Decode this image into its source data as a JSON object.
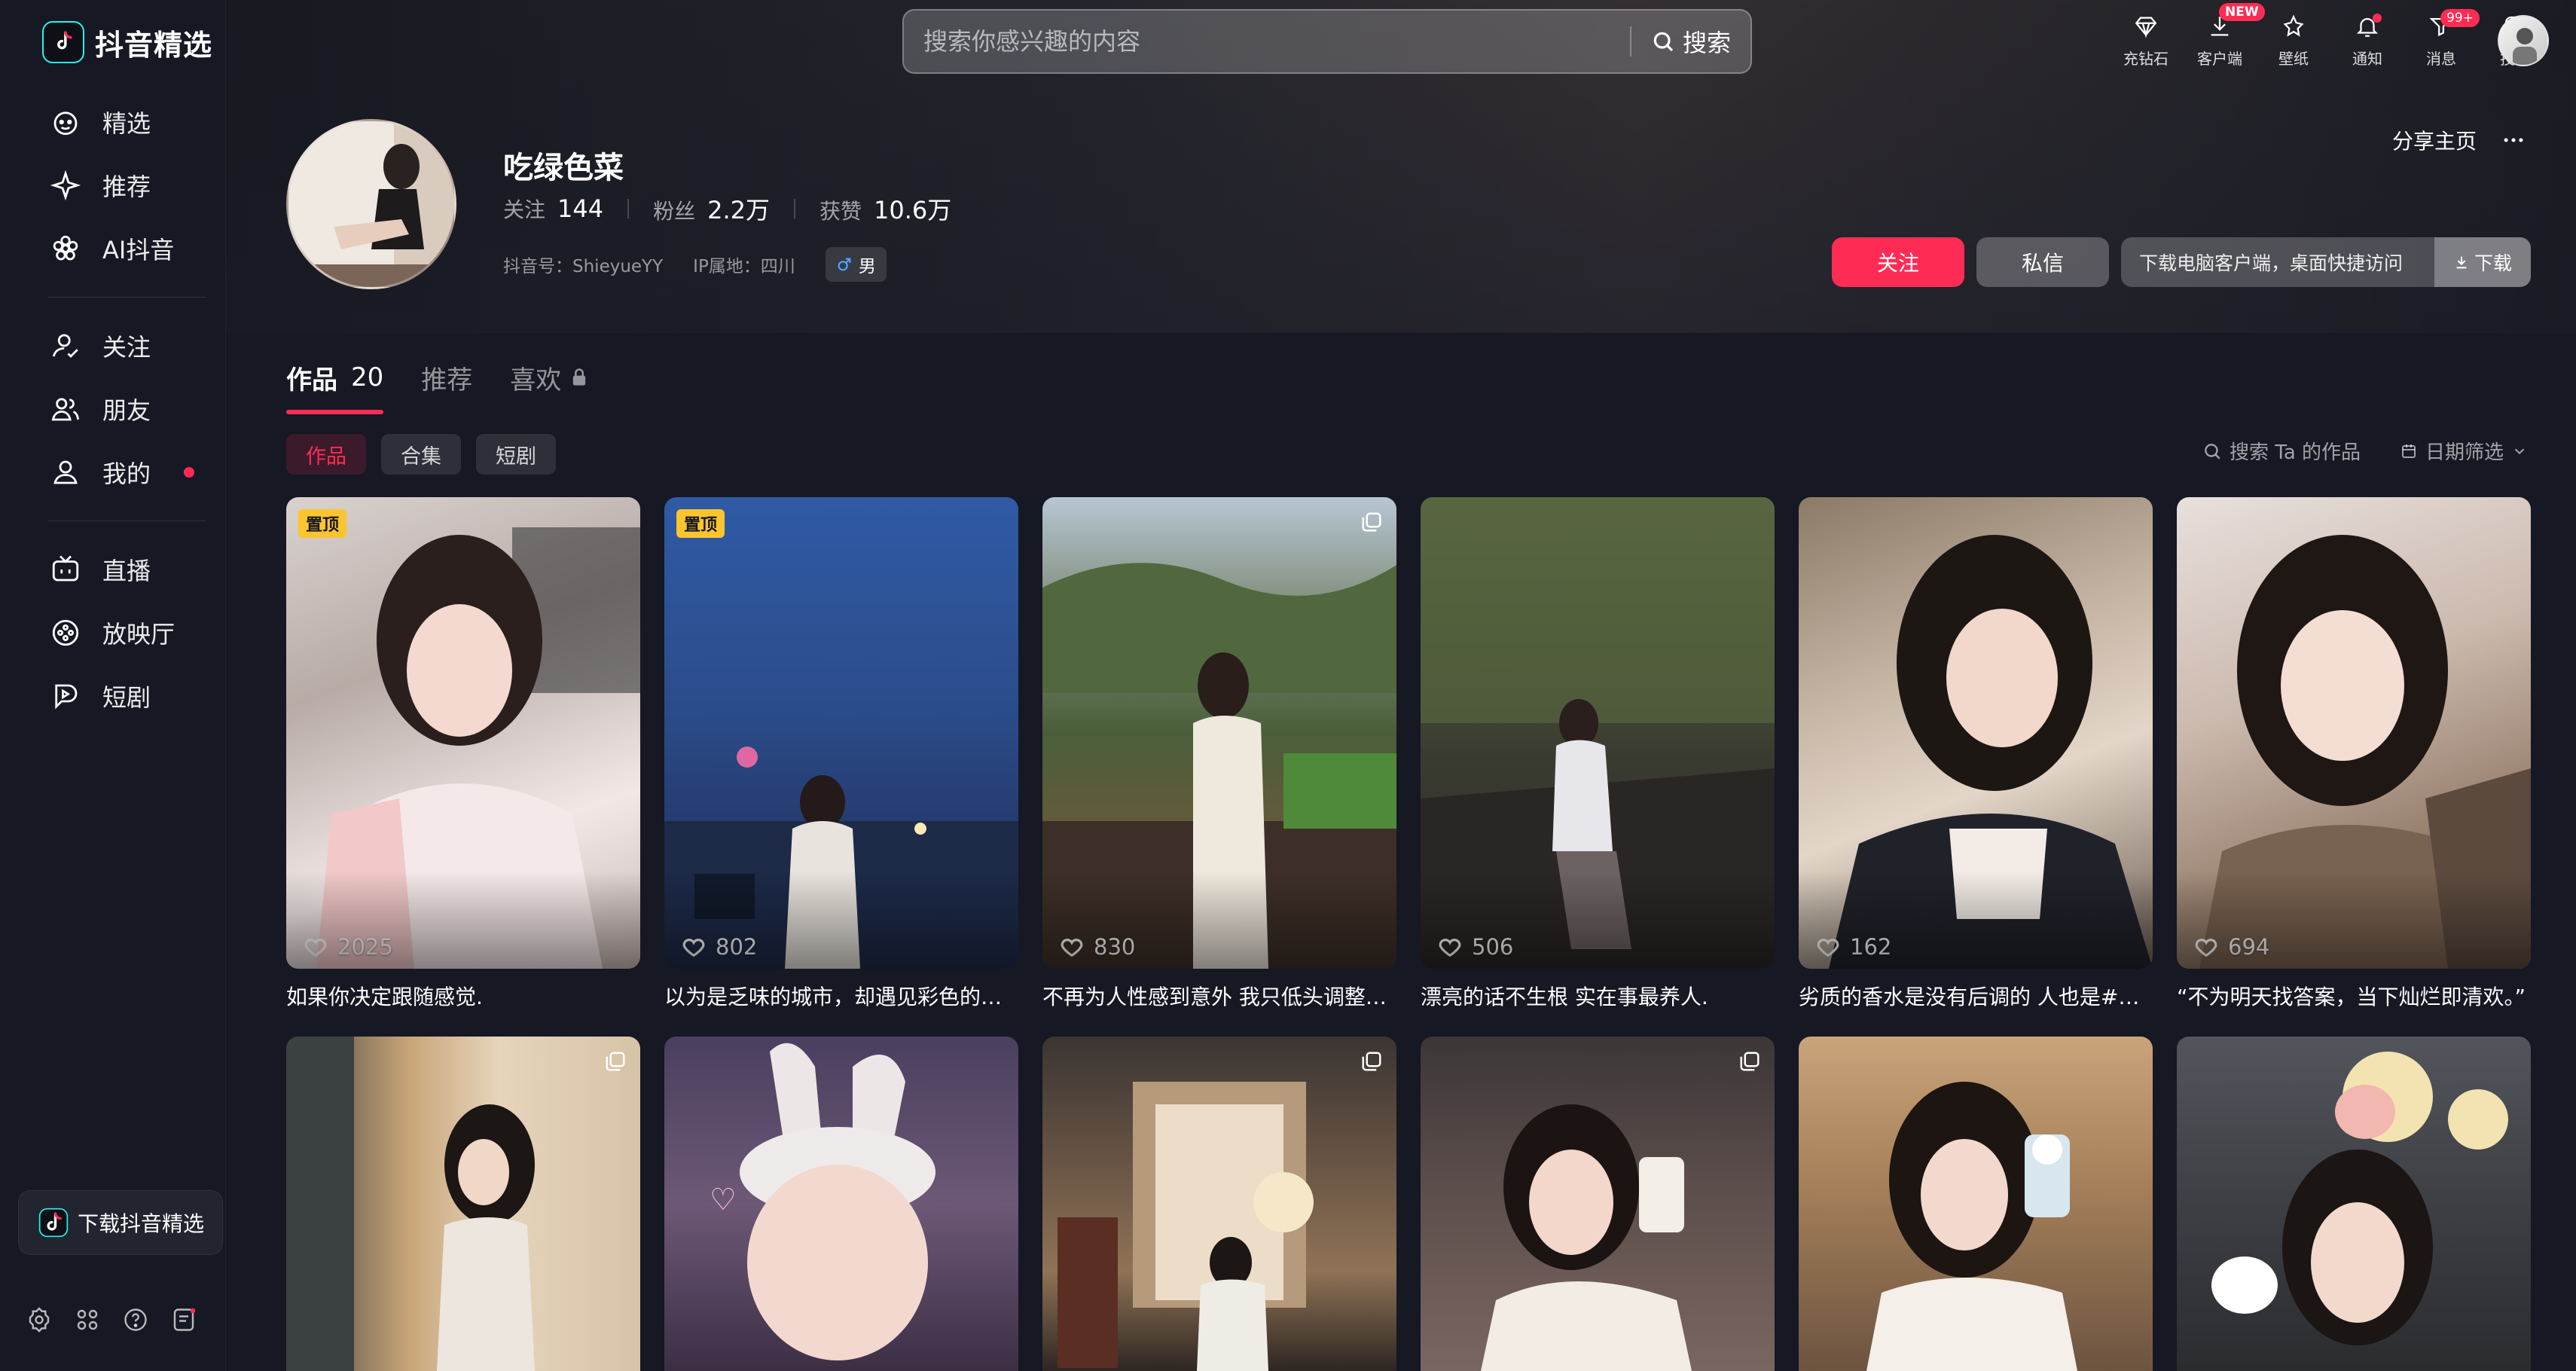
{
  "brand": {
    "name": "抖音精选"
  },
  "sidebar": {
    "items": [
      {
        "label": "精选",
        "icon": "featured-icon"
      },
      {
        "label": "推荐",
        "icon": "sparkle-icon"
      },
      {
        "label": "AI抖音",
        "icon": "ai-flower-icon"
      },
      {
        "label": "关注",
        "icon": "follow-icon"
      },
      {
        "label": "朋友",
        "icon": "friends-icon"
      },
      {
        "label": "我的",
        "icon": "user-icon"
      },
      {
        "label": "直播",
        "icon": "tv-icon"
      },
      {
        "label": "放映厅",
        "icon": "cinema-icon"
      },
      {
        "label": "短剧",
        "icon": "short-drama-icon"
      }
    ],
    "download_label": "下载抖音精选"
  },
  "search": {
    "placeholder": "搜索你感兴趣的内容",
    "button": "搜索"
  },
  "topbar": {
    "tools": [
      {
        "label": "充钻石",
        "icon": "diamond-icon"
      },
      {
        "label": "客户端",
        "icon": "download-icon",
        "badge": "NEW"
      },
      {
        "label": "壁纸",
        "icon": "wallpaper-icon"
      },
      {
        "label": "通知",
        "icon": "bell-icon"
      },
      {
        "label": "消息",
        "icon": "message-icon",
        "badge": "99+"
      },
      {
        "label": "投稿",
        "icon": "upload-plus-icon"
      }
    ]
  },
  "profile": {
    "name": "吃绿色菜",
    "following_label": "关注",
    "following": "144",
    "followers_label": "粉丝",
    "followers": "2.2万",
    "likes_label": "获赞",
    "likes": "10.6万",
    "douyin_id": "抖音号：ShieyueYY",
    "ip": "IP属地：四川",
    "gender": "男",
    "share": "分享主页",
    "follow_btn": "关注",
    "message_btn": "私信",
    "download_tip": "下载电脑客户端，桌面快捷访问",
    "download_btn": "下载"
  },
  "tabs": [
    {
      "label": "作品",
      "count": "20"
    },
    {
      "label": "推荐"
    },
    {
      "label": "喜欢"
    }
  ],
  "chips": [
    "作品",
    "合集",
    "短剧"
  ],
  "tools_right": {
    "search": "搜索 Ta 的作品",
    "date": "日期筛选"
  },
  "pin_label": "置顶",
  "videos": [
    {
      "likes": "2025",
      "caption": "如果你决定跟随感觉.",
      "pinned": true
    },
    {
      "likes": "802",
      "caption": "以为是乏味的城市，却遇见彩色的…",
      "pinned": true
    },
    {
      "likes": "830",
      "caption": "不再为人性感到意外 我只低头调整…",
      "multi": true
    },
    {
      "likes": "506",
      "caption": "漂亮的话不生根 实在事最养人."
    },
    {
      "likes": "162",
      "caption": "劣质的香水是没有后调的 人也是#…"
    },
    {
      "likes": "694",
      "caption": "“不为明天找答案，当下灿烂即清欢。”"
    },
    {
      "multi": true
    },
    {},
    {
      "multi": true
    },
    {
      "multi": true
    },
    {},
    {}
  ],
  "colors": {
    "accent": "#fe2c55",
    "pin": "#fcc52e",
    "bg": "#161823"
  }
}
